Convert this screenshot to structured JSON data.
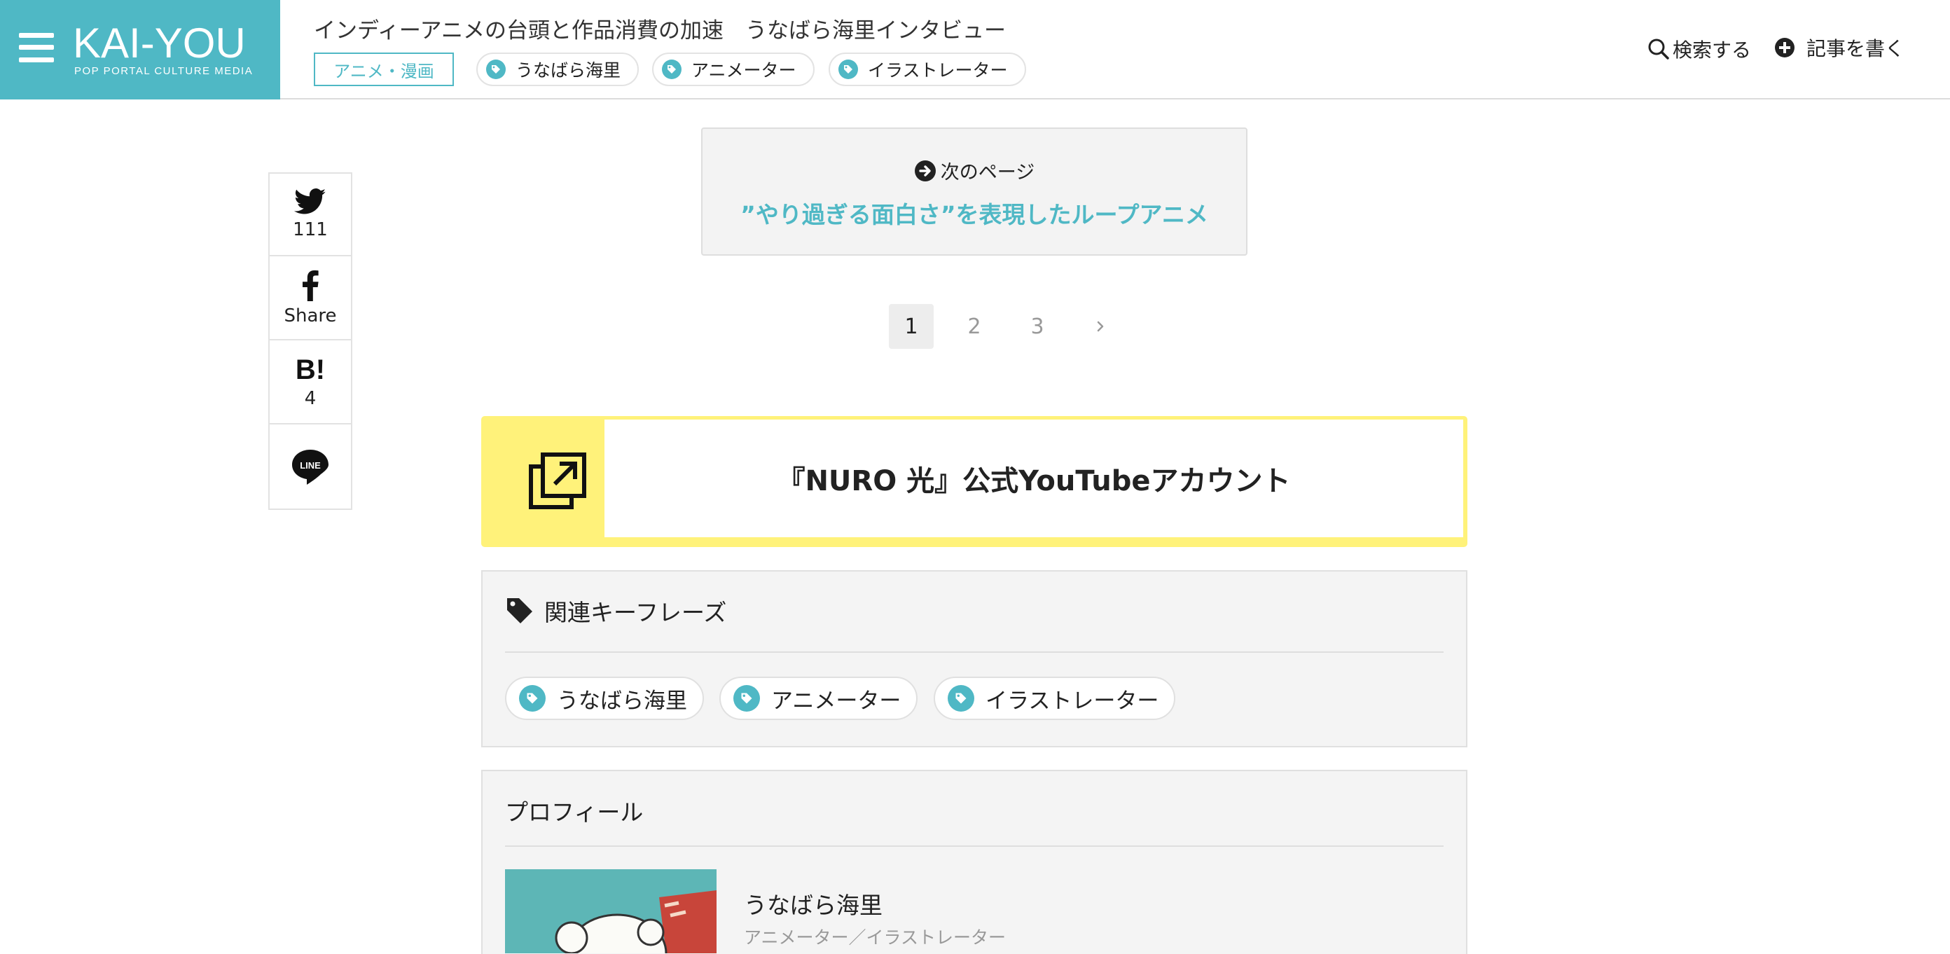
{
  "header": {
    "logo": "KAI-YOU",
    "logo_subtitle": "POP PORTAL CULTURE MEDIA",
    "article_title": "インディーアニメの台頭と作品消費の加速　うなばら海里インタビュー",
    "category": "アニメ・漫画",
    "tags": [
      "うなばら海里",
      "アニメーター",
      "イラストレーター"
    ],
    "search_label": "検索する",
    "write_label": "記事を書く",
    "brand_color": "#4fb8c5"
  },
  "share": {
    "twitter_count": "111",
    "facebook_label": "Share",
    "hatena_label": "B!",
    "hatena_count": "4",
    "line_label": "LINE"
  },
  "next_page": {
    "label": "次のページ",
    "title": "”やり過ぎる面白さ”を表現したループアニメ"
  },
  "pagination": {
    "pages": [
      "1",
      "2",
      "3"
    ],
    "current": "1",
    "next_symbol": "›"
  },
  "banner": {
    "text": "『NURO 光』公式YouTubeアカウント",
    "accent_color": "#fff27a"
  },
  "keyphrases": {
    "heading": "関連キーフレーズ",
    "items": [
      "うなばら海里",
      "アニメーター",
      "イラストレーター"
    ]
  },
  "profile": {
    "heading": "プロフィール",
    "name": "うなばら海里",
    "role": "アニメーター／イラストレーター"
  }
}
